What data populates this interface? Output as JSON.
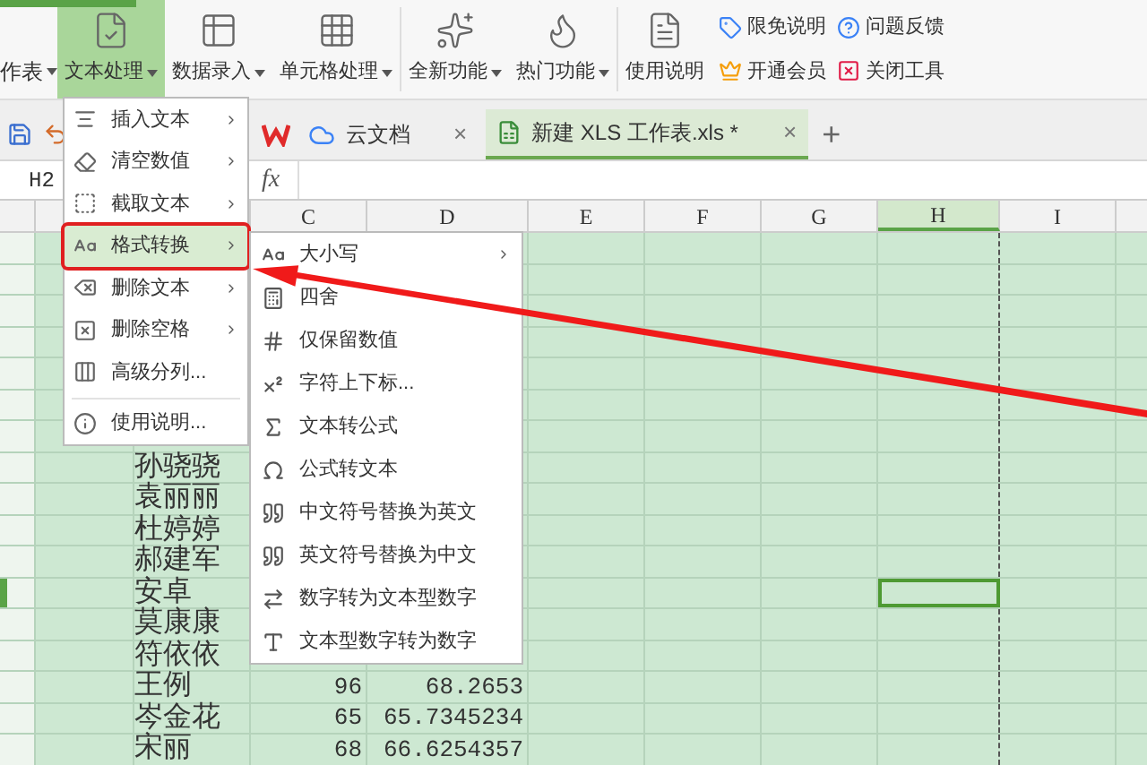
{
  "ribbon": {
    "cut_label": "作表",
    "buttons": [
      {
        "label": "文本处理",
        "kind": "text",
        "dropdown": true,
        "selected": true
      },
      {
        "label": "数据录入",
        "kind": "entry",
        "dropdown": true,
        "selected": false
      },
      {
        "label": "单元格处理",
        "kind": "cell",
        "dropdown": true,
        "selected": false
      },
      {
        "label": "全新功能",
        "kind": "new",
        "dropdown": true,
        "selected": false
      },
      {
        "label": "热门功能",
        "kind": "hot",
        "dropdown": true,
        "selected": false
      },
      {
        "label": "使用说明",
        "kind": "guide",
        "dropdown": false,
        "selected": false
      }
    ],
    "links": [
      {
        "label": "限免说明",
        "kind": "tag"
      },
      {
        "label": "问题反馈",
        "kind": "help"
      },
      {
        "label": "开通会员",
        "kind": "crown"
      },
      {
        "label": "关闭工具",
        "kind": "close"
      }
    ]
  },
  "tabs": [
    {
      "label": "云文档",
      "kind": "cloud",
      "selected": false,
      "close": "×"
    },
    {
      "label": "新建 XLS 工作表.xls *",
      "kind": "sheet",
      "selected": true,
      "close": "×"
    }
  ],
  "new_tab": "+",
  "formula_bar": {
    "name_box": "H2",
    "fx": "fx"
  },
  "columns": [
    {
      "label": "C",
      "selected": false
    },
    {
      "label": "D",
      "selected": false
    },
    {
      "label": "E",
      "selected": false
    },
    {
      "label": "F",
      "selected": false
    },
    {
      "label": "G",
      "selected": false
    },
    {
      "label": "H",
      "selected": true
    },
    {
      "label": "I",
      "selected": false
    }
  ],
  "rows": [
    {
      "name": "孙骁骁",
      "score": "",
      "value": "",
      "selected": false
    },
    {
      "name": "袁丽丽",
      "score": "",
      "value": "",
      "selected": false
    },
    {
      "name": "杜婷婷",
      "score": "",
      "value": "",
      "selected": false
    },
    {
      "name": "郝建军",
      "score": "",
      "value": "",
      "selected": false
    },
    {
      "name": "安卓",
      "score": "",
      "value": "",
      "selected": true
    },
    {
      "name": "莫康康",
      "score": "",
      "value": "",
      "selected": false
    },
    {
      "name": "符依依",
      "score": "",
      "value": "",
      "selected": false
    },
    {
      "name": "王例",
      "score": "96",
      "value": "68.2653",
      "selected": false
    },
    {
      "name": "岑金花",
      "score": "65",
      "value": "65.7345234",
      "selected": false
    },
    {
      "name": "宋丽",
      "score": "68",
      "value": "66.6254357",
      "selected": false
    }
  ],
  "menu": [
    {
      "label": "插入文本",
      "kind": "insert",
      "submenu": true,
      "selected": false
    },
    {
      "label": "清空数值",
      "kind": "clear",
      "submenu": true,
      "selected": false
    },
    {
      "label": "截取文本",
      "kind": "cut",
      "submenu": true,
      "selected": false
    },
    {
      "label": "格式转换",
      "kind": "format",
      "submenu": true,
      "selected": true
    },
    {
      "label": "删除文本",
      "kind": "deltext",
      "submenu": true,
      "selected": false
    },
    {
      "label": "删除空格",
      "kind": "delspace",
      "submenu": true,
      "selected": false
    },
    {
      "label": "高级分列...",
      "kind": "split",
      "submenu": false,
      "selected": false
    },
    {
      "label": "使用说明...",
      "kind": "guide",
      "submenu": false,
      "selected": false
    }
  ],
  "submenu": [
    {
      "label": "大小写",
      "kind": "case",
      "submenu": true
    },
    {
      "label": "四舍",
      "kind": "round",
      "submenu": false
    },
    {
      "label": "仅保留数值",
      "kind": "digits",
      "submenu": false
    },
    {
      "label": "字符上下标...",
      "kind": "script",
      "submenu": false
    },
    {
      "label": "文本转公式",
      "kind": "toformula",
      "submenu": false
    },
    {
      "label": "公式转文本",
      "kind": "totext",
      "submenu": false
    },
    {
      "label": "中文符号替换为英文",
      "kind": "toen",
      "submenu": false
    },
    {
      "label": "英文符号替换为中文",
      "kind": "tocn",
      "submenu": false
    },
    {
      "label": "数字转为文本型数字",
      "kind": "numtext",
      "submenu": false
    },
    {
      "label": "文本型数字转为数字",
      "kind": "textnum",
      "submenu": false
    }
  ]
}
